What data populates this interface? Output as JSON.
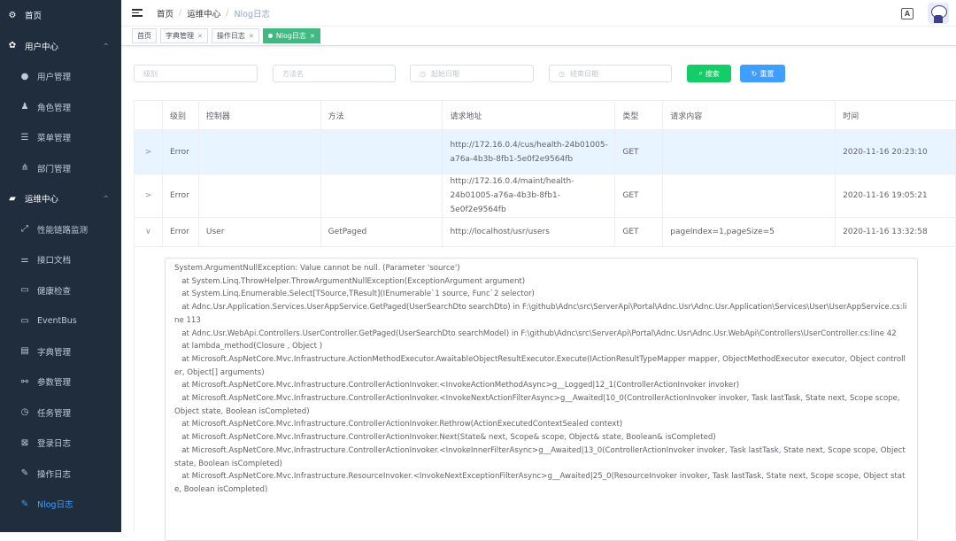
{
  "sidebar": {
    "items": [
      {
        "type": "top",
        "icon": "dashboard-icon",
        "glyph": "⚙",
        "label": "首页"
      },
      {
        "type": "top",
        "icon": "gear-icon",
        "glyph": "✿",
        "label": "用户中心",
        "arrow": "^"
      },
      {
        "type": "sub",
        "icon": "user-icon",
        "glyph": "●",
        "label": "用户管理"
      },
      {
        "type": "sub",
        "icon": "role-icon",
        "glyph": "♟",
        "label": "角色管理"
      },
      {
        "type": "sub",
        "icon": "menu-icon",
        "glyph": "☰",
        "label": "菜单管理"
      },
      {
        "type": "sub",
        "icon": "tree-icon",
        "glyph": "⋔",
        "label": "部门管理"
      },
      {
        "type": "top",
        "icon": "server-icon",
        "glyph": "▰",
        "label": "运维中心",
        "arrow": "^"
      },
      {
        "type": "sub",
        "icon": "monitor-icon",
        "glyph": "⤢",
        "label": "性能链路监测"
      },
      {
        "type": "sub",
        "icon": "api-doc-icon",
        "glyph": "⚌",
        "label": "接口文档"
      },
      {
        "type": "sub",
        "icon": "health-icon",
        "glyph": "▭",
        "label": "健康检查"
      },
      {
        "type": "sub",
        "icon": "eventbus-icon",
        "glyph": "▭",
        "label": "EventBus"
      },
      {
        "type": "sub",
        "icon": "dict-icon",
        "glyph": "▤",
        "label": "字典管理"
      },
      {
        "type": "sub",
        "icon": "params-icon",
        "glyph": "⚯",
        "label": "参数管理"
      },
      {
        "type": "sub",
        "icon": "clock-icon",
        "glyph": "◷",
        "label": "任务管理"
      },
      {
        "type": "sub",
        "icon": "login-log-icon",
        "glyph": "⊠",
        "label": "登录日志"
      },
      {
        "type": "sub",
        "icon": "op-log-icon",
        "glyph": "✎",
        "label": "操作日志"
      },
      {
        "type": "sub",
        "icon": "nlog-icon",
        "glyph": "✎",
        "label": "Nlog日志",
        "active": true
      }
    ]
  },
  "breadcrumb": {
    "home": "首页",
    "section": "运维中心",
    "current": "Nlog日志",
    "sep": "/"
  },
  "navbar": {
    "lang_glyph": "A"
  },
  "tags": [
    {
      "label": "首页",
      "closable": false,
      "active": false
    },
    {
      "label": "字典管理",
      "closable": true,
      "active": false
    },
    {
      "label": "操作日志",
      "closable": true,
      "active": false
    },
    {
      "label": "Nlog日志",
      "closable": true,
      "active": true
    }
  ],
  "filters": {
    "level_placeholder": "级别",
    "method_placeholder": "方法名",
    "start_placeholder": "起始日期",
    "end_placeholder": "结束日期",
    "search_label": "搜索",
    "reset_label": "重置"
  },
  "table": {
    "headers": [
      "",
      "级别",
      "控制器",
      "方法",
      "请求地址",
      "类型",
      "请求内容",
      "时间"
    ],
    "rows": [
      {
        "expand": ">",
        "level": "Error",
        "controller": "",
        "method": "",
        "url": "http://172.16.0.4/cus/health-24b01005-a76a-4b3b-8fb1-5e0f2e9564fb",
        "type": "GET",
        "content": "",
        "time": "2020-11-16 20:23:10",
        "highlight": true
      },
      {
        "expand": ">",
        "level": "Error",
        "controller": "",
        "method": "",
        "url": "http://172.16.0.4/maint/health-24b01005-a76a-4b3b-8fb1-5e0f2e9564fb",
        "type": "GET",
        "content": "",
        "time": "2020-11-16 19:05:21",
        "highlight": false
      },
      {
        "expand": "∨",
        "level": "Error",
        "controller": "User",
        "method": "GetPaged",
        "url": "http://localhost/usr/users",
        "type": "GET",
        "content": "pageIndex=1,pageSize=5",
        "time": "2020-11-16 13:32:58",
        "highlight": false
      }
    ]
  },
  "exception_lines": [
    "System.ArgumentNullException: Value cannot be null. (Parameter 'source')",
    "   at System.Linq.ThrowHelper.ThrowArgumentNullException(ExceptionArgument argument)",
    "   at System.Linq.Enumerable.Select[TSource,TResult](IEnumerable`1 source, Func`2 selector)",
    "   at Adnc.Usr.Application.Services.UserAppService.GetPaged(UserSearchDto searchDto) in F:\\github\\Adnc\\src\\ServerApi\\Portal\\Adnc.Usr\\Adnc.Usr.Application\\Services\\User\\UserAppService.cs:line 113",
    "   at Adnc.Usr.WebApi.Controllers.UserController.GetPaged(UserSearchDto searchModel) in F:\\github\\Adnc\\src\\ServerApi\\Portal\\Adnc.Usr\\Adnc.Usr.WebApi\\Controllers\\UserController.cs:line 42",
    "   at lambda_method(Closure , Object )",
    "   at Microsoft.AspNetCore.Mvc.Infrastructure.ActionMethodExecutor.AwaitableObjectResultExecutor.Execute(IActionResultTypeMapper mapper, ObjectMethodExecutor executor, Object controller, Object[] arguments)",
    "   at Microsoft.AspNetCore.Mvc.Infrastructure.ControllerActionInvoker.<InvokeActionMethodAsync>g__Logged|12_1(ControllerActionInvoker invoker)",
    "   at Microsoft.AspNetCore.Mvc.Infrastructure.ControllerActionInvoker.<InvokeNextActionFilterAsync>g__Awaited|10_0(ControllerActionInvoker invoker, Task lastTask, State next, Scope scope, Object state, Boolean isCompleted)",
    "   at Microsoft.AspNetCore.Mvc.Infrastructure.ControllerActionInvoker.Rethrow(ActionExecutedContextSealed context)",
    "   at Microsoft.AspNetCore.Mvc.Infrastructure.ControllerActionInvoker.Next(State& next, Scope& scope, Object& state, Boolean& isCompleted)",
    "   at Microsoft.AspNetCore.Mvc.Infrastructure.ControllerActionInvoker.<InvokeInnerFilterAsync>g__Awaited|13_0(ControllerActionInvoker invoker, Task lastTask, State next, Scope scope, Object state, Boolean isCompleted)",
    "   at Microsoft.AspNetCore.Mvc.Infrastructure.ResourceInvoker.<InvokeNextExceptionFilterAsync>g__Awaited|25_0(ResourceInvoker invoker, Task lastTask, State next, Scope scope, Object state, Boolean isCompleted)"
  ],
  "colors": {
    "sidebar_bg": "#1f2d3d",
    "active": "#409eff",
    "tag_active": "#42b983",
    "search": "#13ce66",
    "reset": "#409eff",
    "row_highlight": "#e8f4ff"
  }
}
